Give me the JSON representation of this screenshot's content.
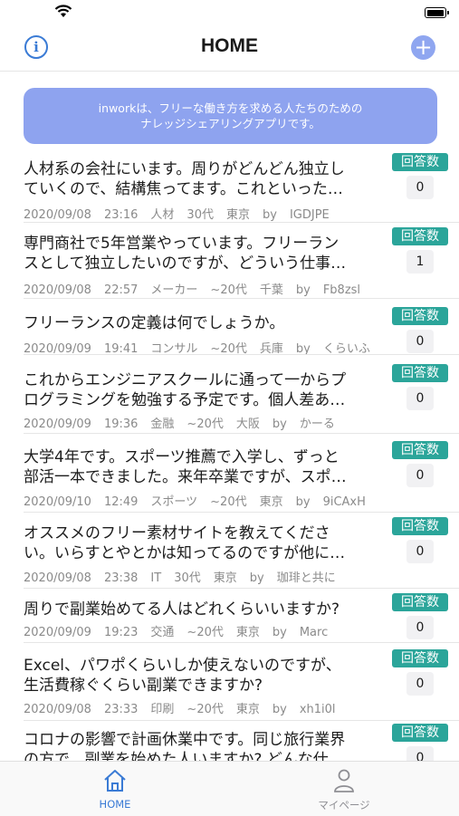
{
  "nav": {
    "title": "HOME",
    "info_glyph": "i",
    "add_glyph": "+"
  },
  "banner": {
    "line1": "inworkは、フリーな働き方を求める人たちのための",
    "line2": "ナレッジシェアリングアプリです。"
  },
  "colors": {
    "accent": "#2ba59a",
    "banner": "#8ea3ef",
    "tab_active": "#3a7bd5"
  },
  "answer_badge_label": "回答数",
  "questions": [
    {
      "line1": "人材系の会社にいます。周りがどんどん独立し",
      "line2": "ていくので、結構焦ってます。これといった…",
      "date": "2020/09/08",
      "time": "23:16",
      "industry": "人材",
      "age": "30代",
      "location": "東京",
      "by": "by",
      "user": "IGDJPE",
      "answers": "0"
    },
    {
      "line1": "専門商社で5年営業やっています。フリーラン",
      "line2": "スとして独立したいのですが、どういう仕事…",
      "date": "2020/09/08",
      "time": "22:57",
      "industry": "メーカー",
      "age": "~20代",
      "location": "千葉",
      "by": "by",
      "user": "Fb8zsl",
      "answers": "1"
    },
    {
      "line1": "フリーランスの定義は何でしょうか。",
      "line2": "",
      "date": "2020/09/09",
      "time": "19:41",
      "industry": "コンサル",
      "age": "~20代",
      "location": "兵庫",
      "by": "by",
      "user": "くらいふ",
      "answers": "0"
    },
    {
      "line1": "これからエンジニアスクールに通って一からプ",
      "line2": "ログラミングを勉強する予定です。個人差あ…",
      "date": "2020/09/09",
      "time": "19:36",
      "industry": "金融",
      "age": "~20代",
      "location": "大阪",
      "by": "by",
      "user": "かーる",
      "answers": "0"
    },
    {
      "line1": "大学4年です。スポーツ推薦で入学し、ずっと",
      "line2": "部活一本できました。来年卒業ですが、スポ…",
      "date": "2020/09/10",
      "time": "12:49",
      "industry": "スポーツ",
      "age": "~20代",
      "location": "東京",
      "by": "by",
      "user": "9iCAxH",
      "answers": "0"
    },
    {
      "line1": "オススメのフリー素材サイトを教えてくださ",
      "line2": "い。いらすとやとかは知ってるのですが他に…",
      "date": "2020/09/08",
      "time": "23:38",
      "industry": "IT",
      "age": "30代",
      "location": "東京",
      "by": "by",
      "user": "珈琲と共に",
      "answers": "0"
    },
    {
      "line1": "周りで副業始めてる人はどれくらいいますか?",
      "line2": "",
      "date": "2020/09/09",
      "time": "19:23",
      "industry": "交通",
      "age": "~20代",
      "location": "東京",
      "by": "by",
      "user": "Marc",
      "answers": "0"
    },
    {
      "line1": "Excel、パワポくらいしか使えないのですが、",
      "line2": "生活費稼ぐくらい副業できますか?",
      "date": "2020/09/08",
      "time": "23:33",
      "industry": "印刷",
      "age": "~20代",
      "location": "東京",
      "by": "by",
      "user": "xh1i0l",
      "answers": "0"
    },
    {
      "line1": "コロナの影響で計画休業中です。同じ旅行業界",
      "line2": "の方で、副業を始めた人いますか? どんな仕…",
      "date": "",
      "time": "",
      "industry": "",
      "age": "",
      "location": "",
      "by": "",
      "user": "",
      "answers": "0"
    }
  ],
  "tabs": {
    "home_label": "HOME",
    "mypage_label": "マイページ"
  }
}
